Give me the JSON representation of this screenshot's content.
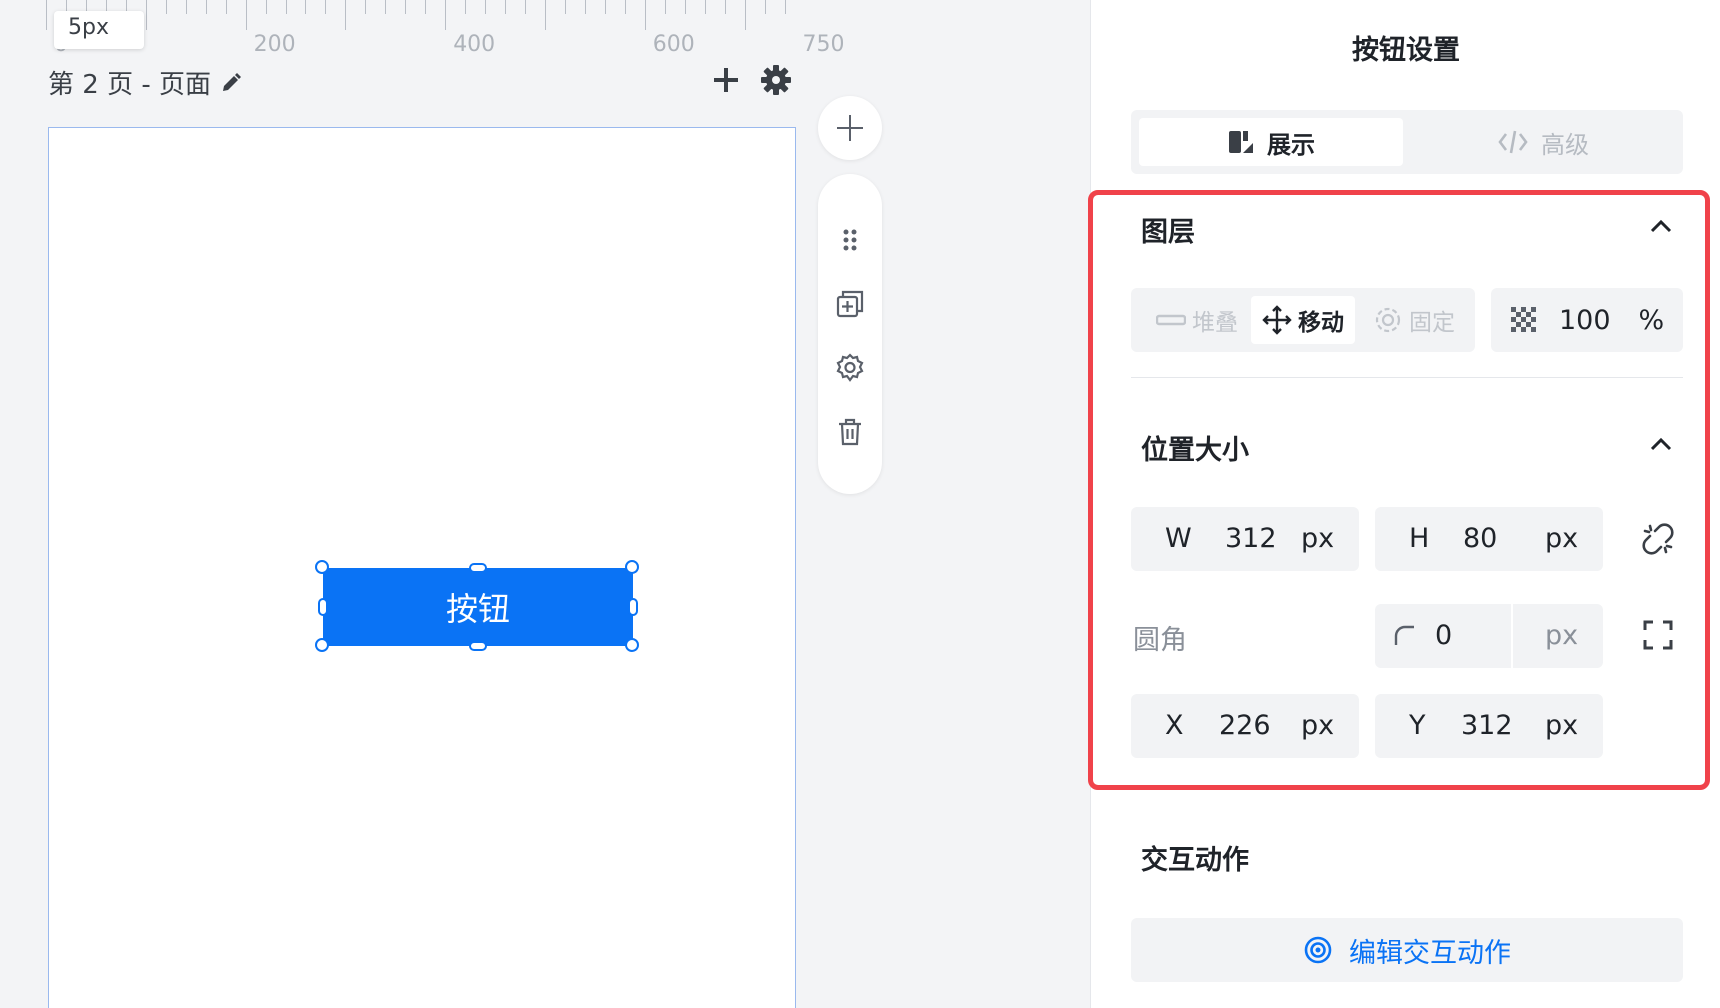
{
  "ruler": {
    "labels": [
      "0",
      "200",
      "400",
      "600",
      "750"
    ],
    "tooltip": "5px"
  },
  "page": {
    "title": "第 2 页 - 页面"
  },
  "canvas_button": {
    "label": "按钮"
  },
  "panel": {
    "title": "按钮设置",
    "tabs": [
      {
        "label": "展示",
        "active": true
      },
      {
        "label": "高级",
        "active": false
      }
    ],
    "layer": {
      "title": "图层",
      "modes": [
        {
          "label": "堆叠",
          "active": false
        },
        {
          "label": "移动",
          "active": true
        },
        {
          "label": "固定",
          "active": false
        }
      ],
      "opacity_value": "100",
      "opacity_unit": "%"
    },
    "position_size": {
      "title": "位置大小",
      "w_label": "W",
      "w_value": "312",
      "w_unit": "px",
      "h_label": "H",
      "h_value": "80",
      "h_unit": "px",
      "radius_label": "圆角",
      "radius_value": "0",
      "radius_unit": "px",
      "x_label": "X",
      "x_value": "226",
      "x_unit": "px",
      "y_label": "Y",
      "y_value": "312",
      "y_unit": "px"
    },
    "interaction": {
      "title": "交互动作",
      "button_label": "编辑交互动作"
    }
  },
  "colors": {
    "accent": "#0a73f5",
    "highlight": "#f0424a"
  },
  "icons": [
    "pencil-icon",
    "plus-icon",
    "gear-icon",
    "drag-handle-icon",
    "copy-icon",
    "settings-icon",
    "trash-icon",
    "display-icon",
    "code-icon",
    "stack-icon",
    "move-icon",
    "pin-icon",
    "opacity-icon",
    "chevron-up-icon",
    "unlink-icon",
    "corner-radius-icon",
    "expand-corners-icon",
    "target-icon"
  ]
}
